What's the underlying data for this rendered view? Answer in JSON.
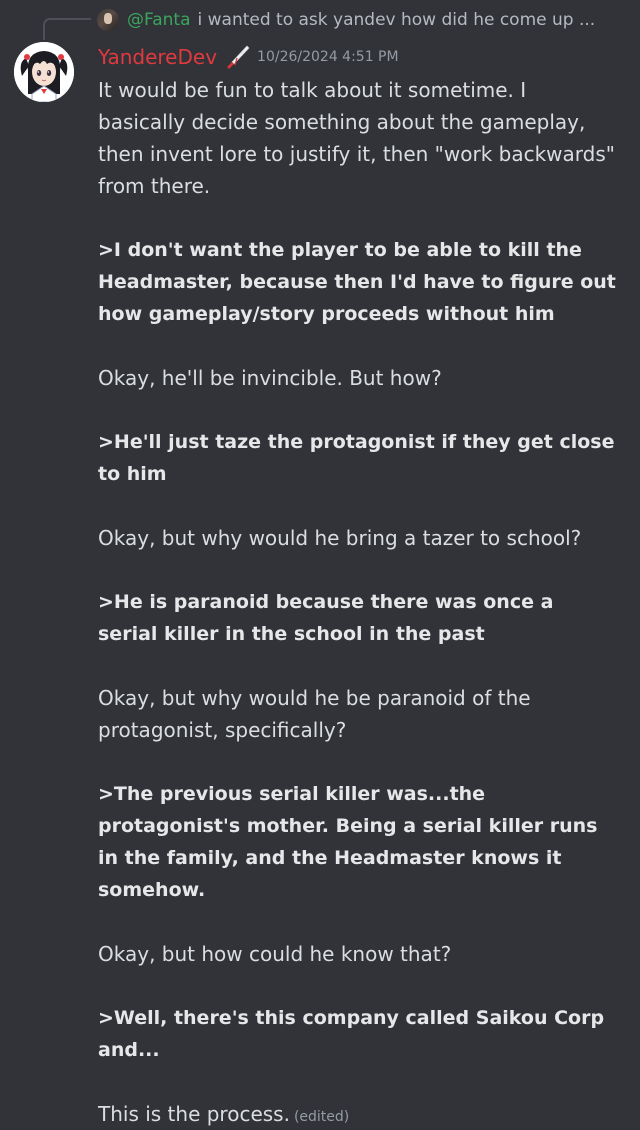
{
  "reply": {
    "username": "@Fanta",
    "text": "i wanted to ask yandev how did he come up ..."
  },
  "message": {
    "author": "YandereDev",
    "author_color": "#e0393e",
    "timestamp": "10/26/2024 4:51 PM",
    "paragraphs": [
      "It would be fun to talk about it sometime. I basically decide something about the gameplay, then invent lore to justify  it, then \"work backwards\" from there.",
      ">I don't want the player to be able to kill the Headmaster, because then I'd have to figure out how gameplay/story proceeds without him",
      "Okay, he'll be invincible. But how?",
      ">He'll just taze the protagonist if they get close to him",
      "Okay, but why would he bring  a tazer to school?",
      ">He is paranoid because there was once a serial killer in the school in the past",
      "Okay, but why would he be paranoid of the protagonist, specifically?",
      ">The previous serial killer was...the protagonist's mother. Being a serial killer runs in the family, and the Headmaster knows it somehow.",
      "Okay, but how could he know that?",
      ">Well, there's this company called Saikou Corp and...",
      "This is the process."
    ],
    "edited_label": "(edited)"
  },
  "icons": {
    "reply_avatar": "user-avatar-icon",
    "avatar": "anime-girl-avatar",
    "badge": "knife-icon"
  }
}
